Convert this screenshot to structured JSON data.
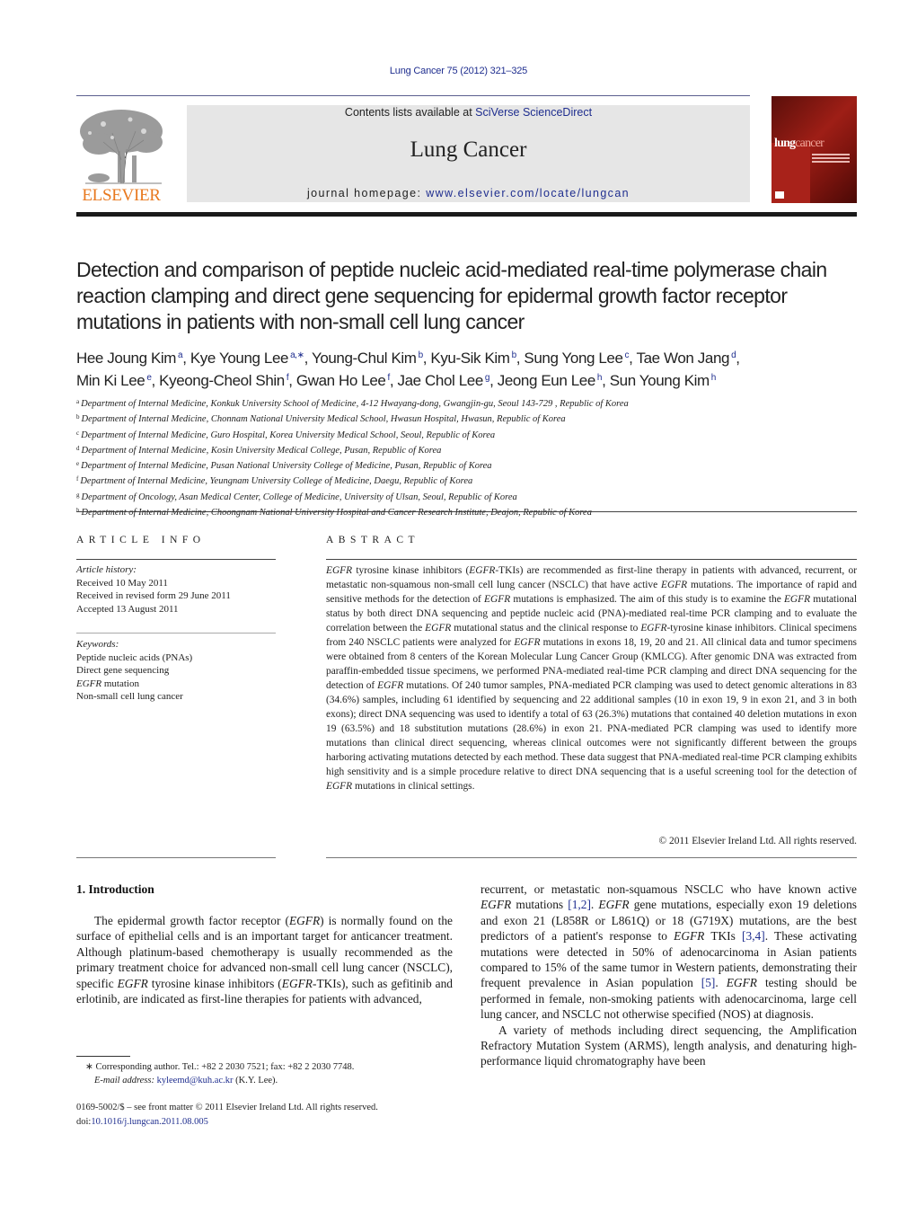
{
  "journal_ref": "Lung Cancer 75 (2012) 321–325",
  "header": {
    "publisher_logo_text": "ELSEVIER",
    "contents_prefix": "Contents lists available at ",
    "contents_link": "SciVerse ScienceDirect",
    "journal_title": "Lung Cancer",
    "homepage_prefix": "journal homepage: ",
    "homepage_link": "www.elsevier.com/locate/lungcan",
    "cover_title_bold": "lung",
    "cover_title_light": "cancer"
  },
  "colors": {
    "link": "#1f2e8f",
    "elsevier_orange": "#e8781e",
    "cover_red": "#9e1e16",
    "header_band": "#e6e6e6"
  },
  "title": "Detection and comparison of peptide nucleic acid-mediated real-time polymerase chain reaction clamping and direct gene sequencing for epidermal growth factor receptor mutations in patients with non-small cell lung cancer",
  "authors": [
    {
      "name": "Hee Joung Kim",
      "aff": "a",
      "sep": ", "
    },
    {
      "name": "Kye Young Lee",
      "aff": "a,∗",
      "sep": ", "
    },
    {
      "name": "Young-Chul Kim",
      "aff": "b",
      "sep": ", "
    },
    {
      "name": "Kyu-Sik Kim",
      "aff": "b",
      "sep": ", "
    },
    {
      "name": "Sung Yong Lee",
      "aff": "c",
      "sep": ", "
    },
    {
      "name": "Tae Won Jang",
      "aff": "d",
      "sep": ", "
    },
    {
      "name": "Min Ki Lee",
      "aff": "e",
      "sep": ", "
    },
    {
      "name": "Kyeong-Cheol Shin",
      "aff": "f",
      "sep": ", "
    },
    {
      "name": "Gwan Ho Lee",
      "aff": "f",
      "sep": ", "
    },
    {
      "name": "Jae Chol Lee",
      "aff": "g",
      "sep": ", "
    },
    {
      "name": "Jeong Eun Lee",
      "aff": "h",
      "sep": ", "
    },
    {
      "name": "Sun Young Kim",
      "aff": "h",
      "sep": ""
    }
  ],
  "affiliations": [
    {
      "key": "a",
      "text": "Department of Internal Medicine, Konkuk University School of Medicine, 4-12 Hwayang-dong, Gwangjin-gu, Seoul 143-729 , Republic of Korea"
    },
    {
      "key": "b",
      "text": "Department of Internal Medicine, Chonnam National University Medical School, Hwasun Hospital, Hwasun, Republic of Korea"
    },
    {
      "key": "c",
      "text": "Department of Internal Medicine, Guro Hospital, Korea University Medical School, Seoul, Republic of Korea"
    },
    {
      "key": "d",
      "text": "Department of Internal Medicine, Kosin University Medical College, Pusan, Republic of Korea"
    },
    {
      "key": "e",
      "text": "Department of Internal Medicine, Pusan National University College of Medicine, Pusan, Republic of Korea"
    },
    {
      "key": "f",
      "text": "Department of Internal Medicine, Yeungnam University College of Medicine, Daegu, Republic of Korea"
    },
    {
      "key": "g",
      "text": "Department of Oncology, Asan Medical Center, College of Medicine, University of Ulsan, Seoul, Republic of Korea"
    },
    {
      "key": "h",
      "text": "Department of Internal Medicine, Choongnam National University Hospital and Cancer Research Institute, Deajon, Republic of Korea"
    }
  ],
  "article_info": {
    "heading": "ARTICLE INFO",
    "history_label": "Article history:",
    "history": [
      "Received 10 May 2011",
      "Received in revised form 29 June 2011",
      "Accepted 13 August 2011"
    ],
    "keywords_label": "Keywords:",
    "keywords": [
      "Peptide nucleic acids (PNAs)",
      "Direct gene sequencing",
      "EGFR mutation",
      "Non-small cell lung cancer"
    ]
  },
  "abstract": {
    "heading": "ABSTRACT",
    "text": "EGFR tyrosine kinase inhibitors (EGFR-TKIs) are recommended as first-line therapy in patients with advanced, recurrent, or metastatic non-squamous non-small cell lung cancer (NSCLC) that have active EGFR mutations. The importance of rapid and sensitive methods for the detection of EGFR mutations is emphasized. The aim of this study is to examine the EGFR mutational status by both direct DNA sequencing and peptide nucleic acid (PNA)-mediated real-time PCR clamping and to evaluate the correlation between the EGFR mutational status and the clinical response to EGFR-tyrosine kinase inhibitors. Clinical specimens from 240 NSCLC patients were analyzed for EGFR mutations in exons 18, 19, 20 and 21. All clinical data and tumor specimens were obtained from 8 centers of the Korean Molecular Lung Cancer Group (KMLCG). After genomic DNA was extracted from paraffin-embedded tissue specimens, we performed PNA-mediated real-time PCR clamping and direct DNA sequencing for the detection of EGFR mutations. Of 240 tumor samples, PNA-mediated PCR clamping was used to detect genomic alterations in 83 (34.6%) samples, including 61 identified by sequencing and 22 additional samples (10 in exon 19, 9 in exon 21, and 3 in both exons); direct DNA sequencing was used to identify a total of 63 (26.3%) mutations that contained 40 deletion mutations in exon 19 (63.5%) and 18 substitution mutations (28.6%) in exon 21. PNA-mediated PCR clamping was used to identify more mutations than clinical direct sequencing, whereas clinical outcomes were not significantly different between the groups harboring activating mutations detected by each method. These data suggest that PNA-mediated real-time PCR clamping exhibits high sensitivity and is a simple procedure relative to direct DNA sequencing that is a useful screening tool for the detection of EGFR mutations in clinical settings.",
    "copyright": "© 2011 Elsevier Ireland Ltd. All rights reserved."
  },
  "body": {
    "section_heading": "1.  Introduction",
    "left_paragraph": "The epidermal growth factor receptor (EGFR) is normally found on the surface of epithelial cells and is an important target for anticancer treatment. Although platinum-based chemotherapy is usually recommended as the primary treatment choice for advanced non-small cell lung cancer (NSCLC), specific EGFR tyrosine kinase inhibitors (EGFR-TKIs), such as gefitinib and erlotinib, are indicated as first-line therapies for patients with advanced,",
    "right_paragraph_1": "recurrent, or metastatic non-squamous NSCLC who have known active EGFR mutations [1,2]. EGFR gene mutations, especially exon 19 deletions and exon 21 (L858R or L861Q) or 18 (G719X) mutations, are the best predictors of a patient's response to EGFR TKIs [3,4]. These activating mutations were detected in 50% of adenocarcinoma in Asian patients compared to 15% of the same tumor in Western patients, demonstrating their frequent prevalence in Asian population [5]. EGFR testing should be performed in female, non-smoking patients with adenocarcinoma, large cell lung cancer, and NSCLC not otherwise specified (NOS) at diagnosis.",
    "right_paragraph_2": "A variety of methods including direct sequencing, the Amplification Refractory Mutation System (ARMS), length analysis, and denaturing high-performance liquid chromatography have been"
  },
  "footnote": {
    "marker": "∗",
    "corresponding": "Corresponding author. Tel.: +82 2 2030 7521; fax: +82 2 2030 7748.",
    "email_label": "E-mail address:",
    "email": "kyleemd@kuh.ac.kr",
    "email_suffix": " (K.Y. Lee)."
  },
  "front_matter": {
    "issn_line": "0169-5002/$ – see front matter © 2011 Elsevier Ireland Ltd. All rights reserved.",
    "doi_prefix": "doi:",
    "doi": "10.1016/j.lungcan.2011.08.005"
  }
}
